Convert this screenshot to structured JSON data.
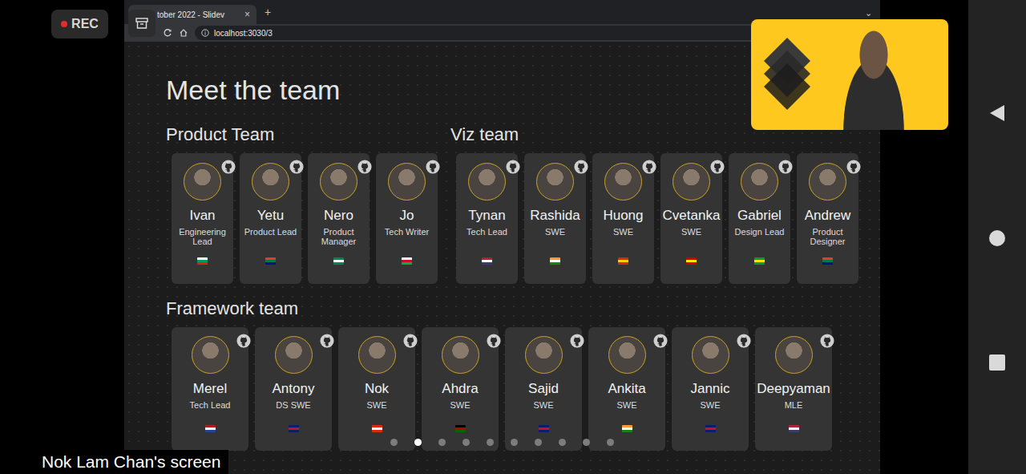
{
  "recording": {
    "label": "REC"
  },
  "browser": {
    "tab_title": "tober 2022 - Slidev",
    "tab_close": "×",
    "new_tab": "+",
    "menu": "⌄",
    "address": "localhost:3030/3"
  },
  "slide": {
    "title": "Meet the team",
    "sections": [
      {
        "title": "Product Team",
        "members": [
          {
            "name": "Ivan",
            "role": "Engineering Lead",
            "flag": [
              "#ffffff",
              "#00966e",
              "#d62612"
            ]
          },
          {
            "name": "Yetu",
            "role": "Product Lead",
            "flag": [
              "#e03c31",
              "#007749",
              "#001489"
            ]
          },
          {
            "name": "Nero",
            "role": "Product Manager",
            "flag": [
              "#008751",
              "#ffffff",
              "#008751"
            ]
          },
          {
            "name": "Jo",
            "role": "Tech Writer",
            "flag": [
              "#ffffff",
              "#d30731",
              "#00b140"
            ]
          }
        ]
      },
      {
        "title": "Viz team",
        "members": [
          {
            "name": "Tynan",
            "role": "Tech Lead",
            "flag": [
              "#b22234",
              "#ffffff",
              "#3c3b6e"
            ]
          },
          {
            "name": "Rashida",
            "role": "SWE",
            "flag": [
              "#ff9933",
              "#ffffff",
              "#138808"
            ]
          },
          {
            "name": "Huong",
            "role": "SWE",
            "flag": [
              "#da251d",
              "#ffcd00",
              "#da251d"
            ]
          },
          {
            "name": "Cvetanka",
            "role": "SWE",
            "flag": [
              "#d20000",
              "#ffe600",
              "#d20000"
            ]
          },
          {
            "name": "Gabriel",
            "role": "Design Lead",
            "flag": [
              "#009c3b",
              "#ffdf00",
              "#009c3b"
            ]
          },
          {
            "name": "Andrew",
            "role": "Product Designer",
            "flag": [
              "#e03c31",
              "#007749",
              "#001489"
            ]
          }
        ]
      },
      {
        "title": "Framework team",
        "members": [
          {
            "name": "Merel",
            "role": "Tech Lead",
            "flag": [
              "#ae1c28",
              "#ffffff",
              "#21468b"
            ]
          },
          {
            "name": "Antony",
            "role": "DS SWE",
            "flag": [
              "#012169",
              "#c8102e",
              "#012169"
            ]
          },
          {
            "name": "Nok",
            "role": "SWE",
            "flag": [
              "#de2910",
              "#ffffff",
              "#de2910"
            ]
          },
          {
            "name": "Ahdra",
            "role": "SWE",
            "flag": [
              "#000000",
              "#bb0000",
              "#006600"
            ]
          },
          {
            "name": "Sajid",
            "role": "SWE",
            "flag": [
              "#012169",
              "#c8102e",
              "#012169"
            ]
          },
          {
            "name": "Ankita",
            "role": "SWE",
            "flag": [
              "#ff9933",
              "#ffffff",
              "#138808"
            ]
          },
          {
            "name": "Jannic",
            "role": "SWE",
            "flag": [
              "#012169",
              "#c8102e",
              "#012169"
            ]
          },
          {
            "name": "Deepyaman",
            "role": "MLE",
            "flag": [
              "#b22234",
              "#ffffff",
              "#3c3b6e"
            ]
          }
        ]
      }
    ],
    "pages": [
      {
        "selected": false
      },
      {
        "selected": true
      },
      {
        "selected": false
      },
      {
        "selected": false
      },
      {
        "selected": false
      },
      {
        "selected": false
      },
      {
        "selected": false
      },
      {
        "selected": false
      },
      {
        "selected": false
      },
      {
        "selected": false
      }
    ]
  },
  "screen_label": "Nok Lam Chan's screen"
}
